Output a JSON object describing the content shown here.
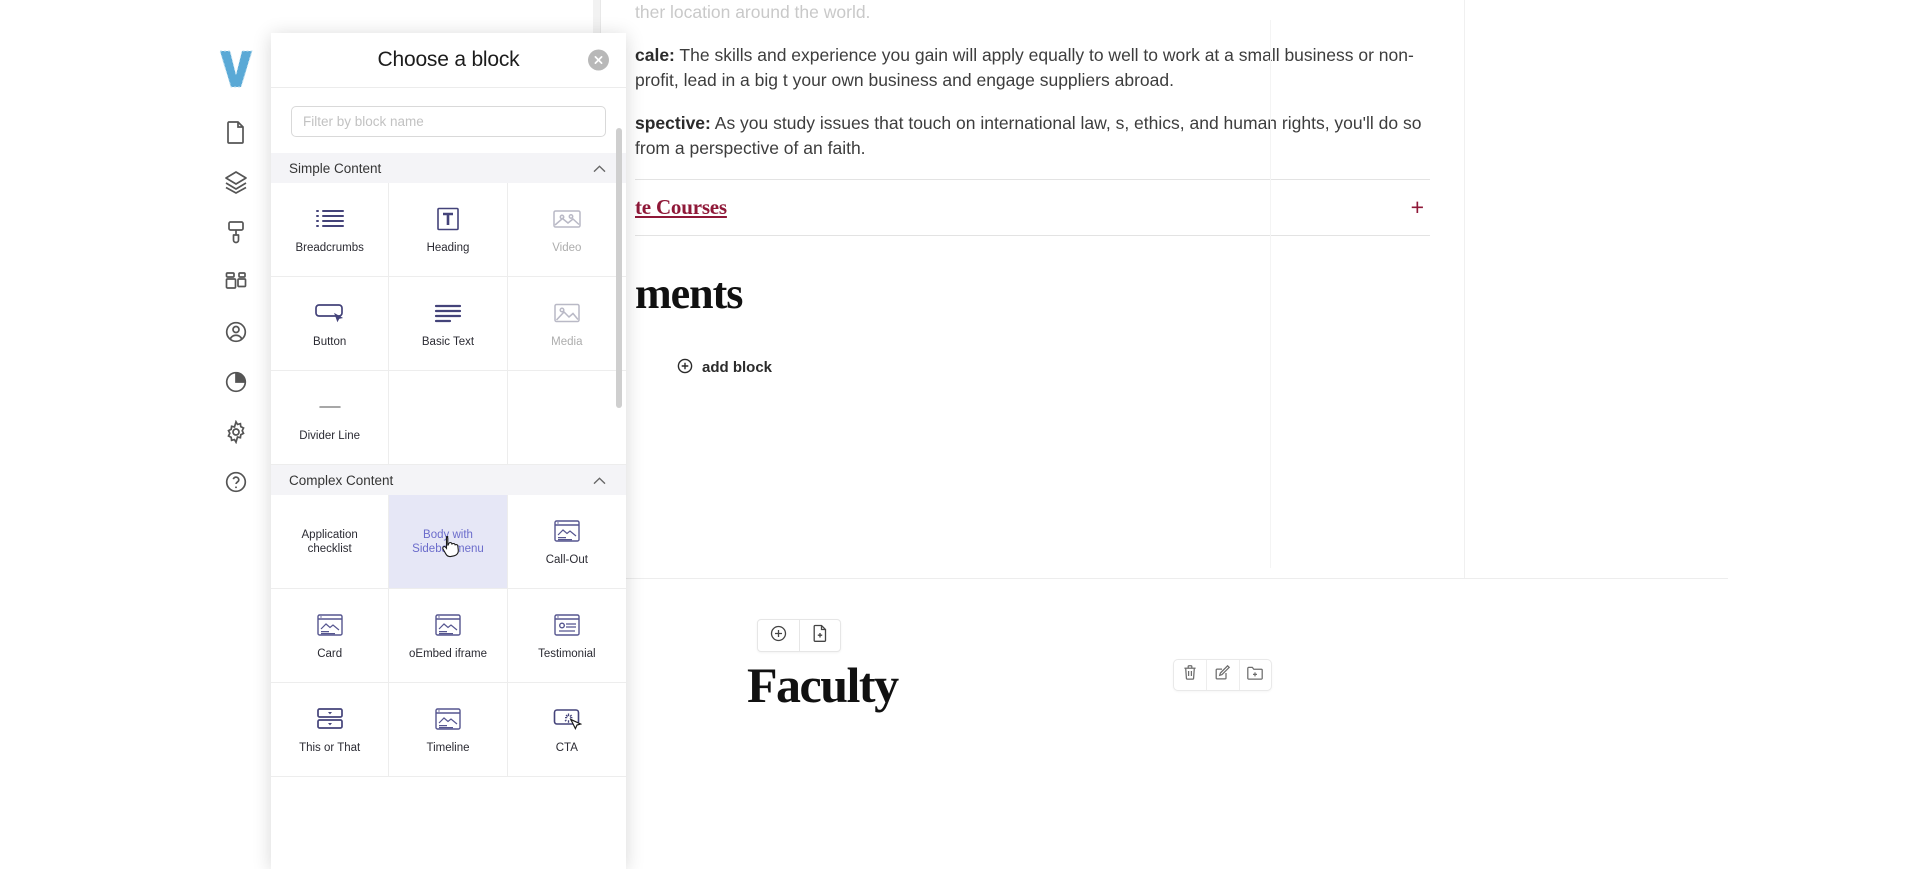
{
  "app": {
    "logo_alt": "V"
  },
  "sidebar": {
    "items": [
      {
        "name": "page-icon",
        "label": "Pages"
      },
      {
        "name": "layers-icon",
        "label": "Layers"
      },
      {
        "name": "paint-icon",
        "label": "Theme"
      },
      {
        "name": "blocks-icon",
        "label": "Blocks"
      },
      {
        "name": "account-icon",
        "label": "Account"
      },
      {
        "name": "analytics-icon",
        "label": "Analytics"
      },
      {
        "name": "gear-icon",
        "label": "Settings"
      },
      {
        "name": "help-icon",
        "label": "Help"
      }
    ]
  },
  "modal": {
    "title": "Choose a block",
    "close_label": "×",
    "filter": {
      "placeholder": "Filter by block name",
      "value": ""
    },
    "groups": [
      {
        "title": "Simple Content",
        "collapse_icon": "chevron-up-icon",
        "blocks": [
          {
            "label": "Breadcrumbs",
            "icon": "list-icon",
            "state": "normal"
          },
          {
            "label": "Heading",
            "icon": "heading-t-icon",
            "state": "normal"
          },
          {
            "label": "Video",
            "icon": "video-icon",
            "state": "disabled"
          },
          {
            "label": "Button",
            "icon": "button-icon",
            "state": "normal"
          },
          {
            "label": "Basic Text",
            "icon": "text-lines-icon",
            "state": "normal"
          },
          {
            "label": "Media",
            "icon": "media-icon",
            "state": "disabled"
          },
          {
            "label": "Divider Line",
            "icon": "divider-icon",
            "state": "normal"
          },
          {
            "label": "",
            "icon": "",
            "state": "empty"
          },
          {
            "label": "",
            "icon": "",
            "state": "empty"
          }
        ]
      },
      {
        "title": "Complex Content",
        "collapse_icon": "chevron-up-icon",
        "blocks": [
          {
            "label": "Application checklist",
            "icon": "none",
            "state": "textonly"
          },
          {
            "label": "Body with Sidebar menu",
            "icon": "none",
            "state": "selected"
          },
          {
            "label": "Call-Out",
            "icon": "layout-icon",
            "state": "normal"
          },
          {
            "label": "Card",
            "icon": "layout-icon",
            "state": "normal"
          },
          {
            "label": "oEmbed iframe",
            "icon": "layout-icon",
            "state": "normal"
          },
          {
            "label": "Testimonial",
            "icon": "quote-box-icon",
            "state": "normal"
          },
          {
            "label": "This or That",
            "icon": "two-rows-icon",
            "state": "normal"
          },
          {
            "label": "Timeline",
            "icon": "layout-icon",
            "state": "normal"
          },
          {
            "label": "CTA",
            "icon": "cta-click-icon",
            "state": "normal"
          }
        ]
      }
    ]
  },
  "document": {
    "paragraph_clipped": "ther location around the world.",
    "paragraphs": [
      {
        "lead": "cale:",
        "rest": " The skills and experience you gain will apply equally to well to work at a small business or non-profit, lead in a big t your own business and engage suppliers abroad."
      },
      {
        "lead": "spective:",
        "rest": " As you study issues that touch on international law, s, ethics, and human rights, you'll do so from a perspective of an faith."
      }
    ],
    "accordion": {
      "link_label": "te Courses",
      "expand_label": "+"
    },
    "section_heading": "ments",
    "add_block_label": "add block"
  },
  "faculty": {
    "toolbar": [
      {
        "name": "add-circle-icon",
        "label": "Add"
      },
      {
        "name": "page-add-icon",
        "label": "New page"
      }
    ],
    "title": "Faculty",
    "right_tools": [
      {
        "name": "trash-icon",
        "label": "Delete"
      },
      {
        "name": "edit-pencil-icon",
        "label": "Edit"
      },
      {
        "name": "folder-add-icon",
        "label": "Move to folder"
      }
    ]
  },
  "colors": {
    "brand_blue": "#5aa9d6",
    "accent_maroon": "#8f1838",
    "selected_bg": "#e6e7f6",
    "selected_text": "#6b6ccb",
    "icon_purple": "#44437a",
    "thumb_gray": "#5b5c66"
  }
}
